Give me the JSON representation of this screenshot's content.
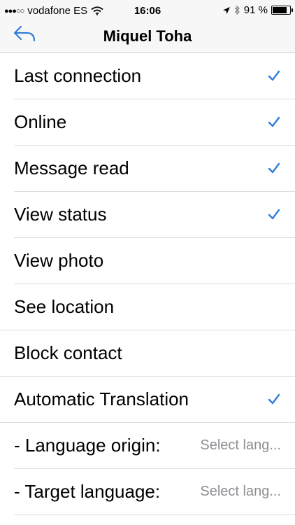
{
  "status_bar": {
    "signal_dots": "●●●○○",
    "carrier": "vodafone ES",
    "time": "16:06",
    "battery_percent": "91 %",
    "battery_level": 0.91
  },
  "nav": {
    "title": "Miquel Toha",
    "back_icon": "reply-arrow-icon"
  },
  "colors": {
    "accent": "#2f7ed8"
  },
  "rows": [
    {
      "label": "Last connection",
      "checked": true
    },
    {
      "label": "Online",
      "checked": true
    },
    {
      "label": "Message read",
      "checked": true
    },
    {
      "label": "View status",
      "checked": true
    },
    {
      "label": "View photo",
      "checked": false
    },
    {
      "label": "See location",
      "checked": false
    },
    {
      "label": "Block contact",
      "checked": false
    },
    {
      "label": "Automatic Translation",
      "checked": true
    },
    {
      "label": "- Language origin:",
      "value": "Select lang..."
    },
    {
      "label": "- Target language:",
      "value": "Select lang..."
    }
  ]
}
